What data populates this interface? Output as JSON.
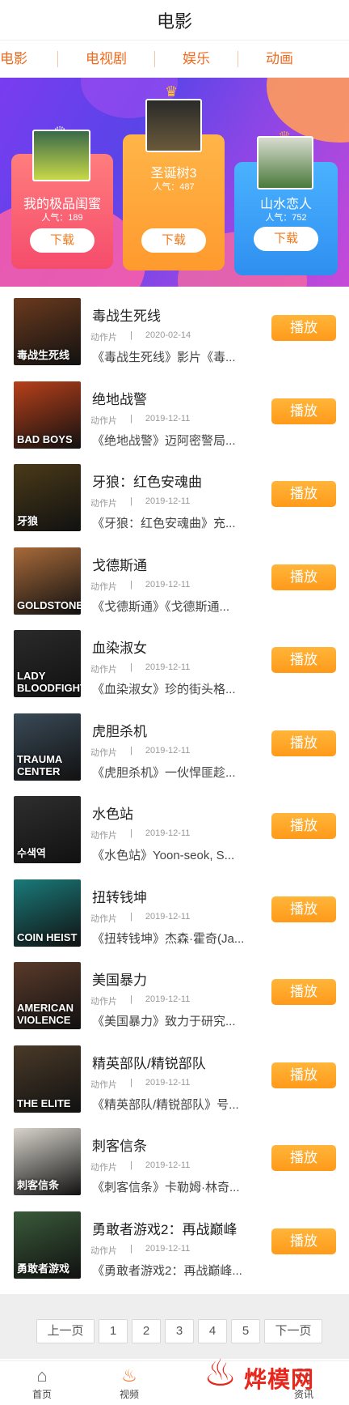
{
  "header": {
    "title": "电影"
  },
  "tabs": [
    "电影",
    "电视剧",
    "娱乐",
    "动画"
  ],
  "banner": {
    "cards": [
      {
        "title": "我的极品闺蜜",
        "popularity": "人气：189",
        "button": "下载"
      },
      {
        "title": "圣诞树3",
        "popularity": "人气：487",
        "button": "下载"
      },
      {
        "title": "山水恋人",
        "popularity": "人气：752",
        "button": "下载"
      }
    ]
  },
  "list": {
    "play_label": "播放",
    "items": [
      {
        "title": "毒战生死线",
        "genre": "动作片",
        "date": "2020-02-14",
        "desc": "《毒战生死线》影片《毒...",
        "poster_text": "毒战生死线",
        "poster_color": "#6b3a1e"
      },
      {
        "title": "绝地战警",
        "genre": "动作片",
        "date": "2019-12-11",
        "desc": "《绝地战警》迈阿密警局...",
        "poster_text": "BAD BOYS",
        "poster_color": "#b8401a"
      },
      {
        "title": "牙狼：红色安魂曲",
        "genre": "动作片",
        "date": "2019-12-11",
        "desc": "《牙狼：红色安魂曲》充...",
        "poster_text": "牙狼",
        "poster_color": "#4a3a18"
      },
      {
        "title": "戈德斯通",
        "genre": "动作片",
        "date": "2019-12-11",
        "desc": "《戈德斯通》《戈德斯通...",
        "poster_text": "GOLDSTONE",
        "poster_color": "#a86a3a"
      },
      {
        "title": "血染淑女",
        "genre": "动作片",
        "date": "2019-12-11",
        "desc": "《血染淑女》珍的街头格...",
        "poster_text": "LADY BLOODFIGHT",
        "poster_color": "#2a2a2a"
      },
      {
        "title": "虎胆杀机",
        "genre": "动作片",
        "date": "2019-12-11",
        "desc": "《虎胆杀机》一伙悍匪趁...",
        "poster_text": "TRAUMA CENTER",
        "poster_color": "#3a4a58"
      },
      {
        "title": "水色站",
        "genre": "动作片",
        "date": "2019-12-11",
        "desc": "《水色站》Yoon-seok, S...",
        "poster_text": "수색역",
        "poster_color": "#2e2e2e"
      },
      {
        "title": "扭转钱坤",
        "genre": "动作片",
        "date": "2019-12-11",
        "desc": "《扭转钱坤》杰森·霍奇(Ja...",
        "poster_text": "COIN HEIST",
        "poster_color": "#1a7a7a"
      },
      {
        "title": "美国暴力",
        "genre": "动作片",
        "date": "2019-12-11",
        "desc": "《美国暴力》致力于研究...",
        "poster_text": "AMERICAN VIOLENCE",
        "poster_color": "#5a3a2a"
      },
      {
        "title": "精英部队/精锐部队",
        "genre": "动作片",
        "date": "2019-12-11",
        "desc": "《精英部队/精锐部队》号...",
        "poster_text": "THE ELITE",
        "poster_color": "#4a3a28"
      },
      {
        "title": "刺客信条",
        "genre": "动作片",
        "date": "2019-12-11",
        "desc": "《刺客信条》卡勒姆·林奇...",
        "poster_text": "刺客信条",
        "poster_color": "#d8d4cc"
      },
      {
        "title": "勇敢者游戏2：再战巅峰",
        "genre": "动作片",
        "date": "2019-12-11",
        "desc": "《勇敢者游戏2：再战巅峰...",
        "poster_text": "勇敢者游戏",
        "poster_color": "#3a5a3a"
      }
    ]
  },
  "pager": {
    "prev": "上一页",
    "pages": [
      "1",
      "2",
      "3",
      "4",
      "5"
    ],
    "next": "下一页"
  },
  "bottom_nav": [
    {
      "label": "首页",
      "icon": "home-icon"
    },
    {
      "label": "视频",
      "icon": "flame-icon"
    },
    {
      "label": "资讯",
      "icon": "news-icon"
    }
  ],
  "brand": {
    "text": "烨模网"
  }
}
